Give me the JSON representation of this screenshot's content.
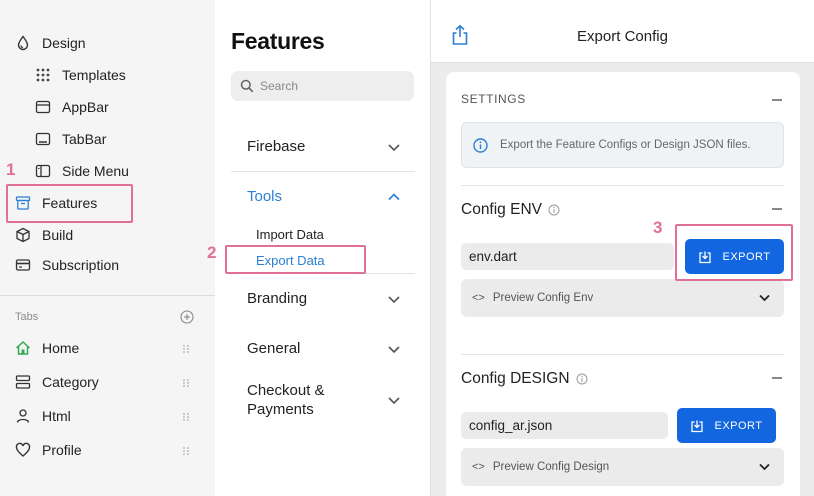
{
  "sidebar": {
    "items": [
      {
        "label": "Design",
        "icon": "drop-icon"
      },
      {
        "label": "Templates",
        "icon": "grid-icon"
      },
      {
        "label": "AppBar",
        "icon": "appbar-icon"
      },
      {
        "label": "TabBar",
        "icon": "tabbar-icon"
      },
      {
        "label": "Side Menu",
        "icon": "side-menu-icon"
      },
      {
        "label": "Features",
        "icon": "archive-icon"
      },
      {
        "label": "Build",
        "icon": "cube-icon"
      },
      {
        "label": "Subscription",
        "icon": "card-icon"
      }
    ],
    "tabs_label": "Tabs",
    "tabs": [
      {
        "label": "Home",
        "icon": "home-icon"
      },
      {
        "label": "Category",
        "icon": "category-icon"
      },
      {
        "label": "Html",
        "icon": "user-icon"
      },
      {
        "label": "Profile",
        "icon": "heart-icon"
      }
    ]
  },
  "features_panel": {
    "title": "Features",
    "search_placeholder": "Search",
    "sections": [
      {
        "label": "Firebase"
      },
      {
        "label": "Tools",
        "sub_items": [
          "Import Data",
          "Export Data"
        ]
      },
      {
        "label": "Branding"
      },
      {
        "label": "General"
      },
      {
        "label": "Checkout & Payments",
        "line1": "Checkout &",
        "line2": "Payments"
      }
    ]
  },
  "export_panel": {
    "title": "Export Config",
    "settings_label": "SETTINGS",
    "info_text": "Export the Feature Configs or Design JSON files.",
    "env": {
      "title": "Config ENV",
      "file": "env.dart",
      "button": "EXPORT",
      "preview": "Preview Config Env"
    },
    "design": {
      "title": "Config DESIGN",
      "file": "config_ar.json",
      "button": "EXPORT",
      "preview": "Preview Config Design"
    }
  },
  "annotations": {
    "step1": "1",
    "step2": "2",
    "step3": "3",
    "color": "#e0709a"
  },
  "colors": {
    "accent": "#1266e0",
    "active_text": "#2b7fd4",
    "tab_home_icon": "#37a852"
  }
}
